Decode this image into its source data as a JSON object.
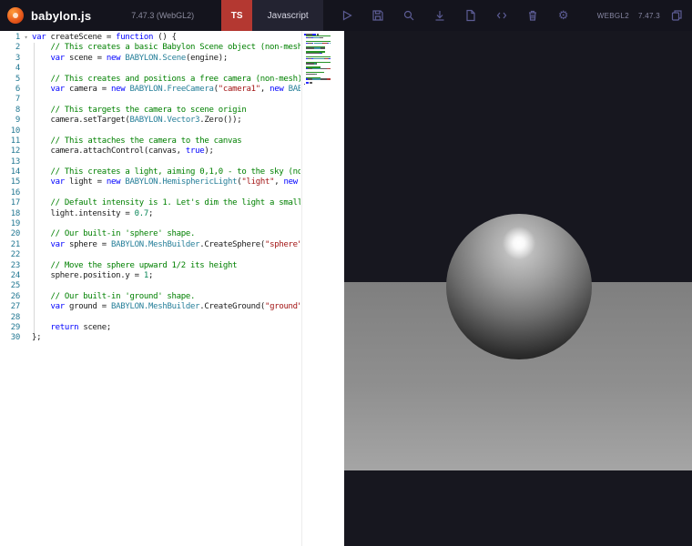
{
  "header": {
    "title": "babylon.js",
    "version": "7.47.3 (WebGL2)",
    "tabs": [
      {
        "label": "TS",
        "active": true
      },
      {
        "label": "Javascript",
        "active": false
      }
    ],
    "toolbar": {
      "icons": [
        "play",
        "save",
        "inspector",
        "download",
        "new-file",
        "embed-code",
        "delete",
        "settings"
      ]
    },
    "right": {
      "webgl": "WEBGL2",
      "version": "7.47.3",
      "icons": [
        "copy"
      ]
    },
    "colors": {
      "bg": "#14141d",
      "tab_active_bg": "#b43831",
      "tab_bg": "#232331",
      "icon": "#5c5c94",
      "version": "#8c8c9f"
    }
  },
  "editor": {
    "language": "Javascript",
    "line_count": 30,
    "token_colors": {
      "kw": "#0000ff",
      "cm": "#008000",
      "st": "#a31515",
      "nm": "#098658",
      "ty": "#267f99",
      "pl": "#1b1b1b"
    },
    "lines": [
      [
        [
          "kw",
          "var"
        ],
        [
          "pl",
          " createScene = "
        ],
        [
          "kw",
          "function"
        ],
        [
          "pl",
          " () {"
        ]
      ],
      [
        [
          "cm",
          "    // This creates a basic Babylon Scene object (non-mesh"
        ]
      ],
      [
        [
          "pl",
          "    "
        ],
        [
          "kw",
          "var"
        ],
        [
          "pl",
          " scene = "
        ],
        [
          "kw",
          "new"
        ],
        [
          "pl",
          " "
        ],
        [
          "ty",
          "BABYLON.Scene"
        ],
        [
          "pl",
          "(engine);"
        ]
      ],
      [],
      [
        [
          "cm",
          "    // This creates and positions a free camera (non-mesh)"
        ]
      ],
      [
        [
          "pl",
          "    "
        ],
        [
          "kw",
          "var"
        ],
        [
          "pl",
          " camera = "
        ],
        [
          "kw",
          "new"
        ],
        [
          "pl",
          " "
        ],
        [
          "ty",
          "BABYLON.FreeCamera"
        ],
        [
          "pl",
          "("
        ],
        [
          "st",
          "\"camera1\""
        ],
        [
          "pl",
          ", "
        ],
        [
          "kw",
          "new"
        ],
        [
          "pl",
          " "
        ],
        [
          "ty",
          "BAB"
        ]
      ],
      [],
      [
        [
          "cm",
          "    // This targets the camera to scene origin"
        ]
      ],
      [
        [
          "pl",
          "    camera.setTarget("
        ],
        [
          "ty",
          "BABYLON.Vector3"
        ],
        [
          "pl",
          ".Zero());"
        ]
      ],
      [],
      [
        [
          "cm",
          "    // This attaches the camera to the canvas"
        ]
      ],
      [
        [
          "pl",
          "    camera.attachControl(canvas, "
        ],
        [
          "kw",
          "true"
        ],
        [
          "pl",
          ");"
        ]
      ],
      [],
      [
        [
          "cm",
          "    // This creates a light, aiming 0,1,0 - to the sky (no"
        ]
      ],
      [
        [
          "pl",
          "    "
        ],
        [
          "kw",
          "var"
        ],
        [
          "pl",
          " light = "
        ],
        [
          "kw",
          "new"
        ],
        [
          "pl",
          " "
        ],
        [
          "ty",
          "BABYLON.HemisphericLight"
        ],
        [
          "pl",
          "("
        ],
        [
          "st",
          "\"light\""
        ],
        [
          "pl",
          ", "
        ],
        [
          "kw",
          "new"
        ],
        [
          "pl",
          " "
        ]
      ],
      [],
      [
        [
          "cm",
          "    // Default intensity is 1. Let's dim the light a small"
        ]
      ],
      [
        [
          "pl",
          "    light.intensity = "
        ],
        [
          "nm",
          "0.7"
        ],
        [
          "pl",
          ";"
        ]
      ],
      [],
      [
        [
          "cm",
          "    // Our built-in 'sphere' shape."
        ]
      ],
      [
        [
          "pl",
          "    "
        ],
        [
          "kw",
          "var"
        ],
        [
          "pl",
          " sphere = "
        ],
        [
          "ty",
          "BABYLON.MeshBuilder"
        ],
        [
          "pl",
          ".CreateSphere("
        ],
        [
          "st",
          "\"sphere\""
        ]
      ],
      [],
      [
        [
          "cm",
          "    // Move the sphere upward 1/2 its height"
        ]
      ],
      [
        [
          "pl",
          "    sphere.position.y = "
        ],
        [
          "nm",
          "1"
        ],
        [
          "pl",
          ";"
        ]
      ],
      [],
      [
        [
          "cm",
          "    // Our built-in 'ground' shape."
        ]
      ],
      [
        [
          "pl",
          "    "
        ],
        [
          "kw",
          "var"
        ],
        [
          "pl",
          " ground = "
        ],
        [
          "ty",
          "BABYLON.MeshBuilder"
        ],
        [
          "pl",
          ".CreateGround("
        ],
        [
          "st",
          "\"ground\""
        ]
      ],
      [],
      [
        [
          "pl",
          "    "
        ],
        [
          "kw",
          "return"
        ],
        [
          "pl",
          " scene;"
        ]
      ],
      [
        [
          "pl",
          "};"
        ]
      ]
    ]
  },
  "scene": {
    "objects": [
      "sphere",
      "ground"
    ],
    "colors": {
      "background": "#17171f",
      "ground_top": "#7f7f7f",
      "ground_bottom": "#a5a5a5",
      "sphere_light": "#cfcfcf",
      "sphere_mid": "#6e6e6e",
      "sphere_dark": "#101010",
      "highlight": "#ffffff"
    }
  }
}
